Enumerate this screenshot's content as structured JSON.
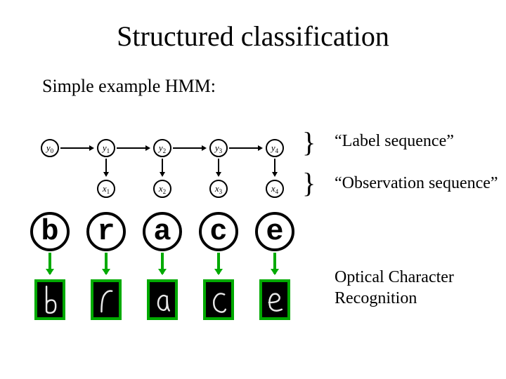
{
  "title": "Structured classification",
  "subtitle": "Simple example HMM:",
  "labels": {
    "label_seq": "“Label sequence”",
    "obs_seq": "“Observation sequence”",
    "ocr_line1": "Optical Character",
    "ocr_line2": "Recognition"
  },
  "nodes": {
    "y": [
      "y",
      "y",
      "y",
      "y",
      "y"
    ],
    "y_sub": [
      "0",
      "1",
      "2",
      "3",
      "4"
    ],
    "x": [
      "x",
      "x",
      "x",
      "x"
    ],
    "x_sub": [
      "1",
      "2",
      "3",
      "4"
    ]
  },
  "letters": [
    "b",
    "r",
    "a",
    "c",
    "e"
  ]
}
